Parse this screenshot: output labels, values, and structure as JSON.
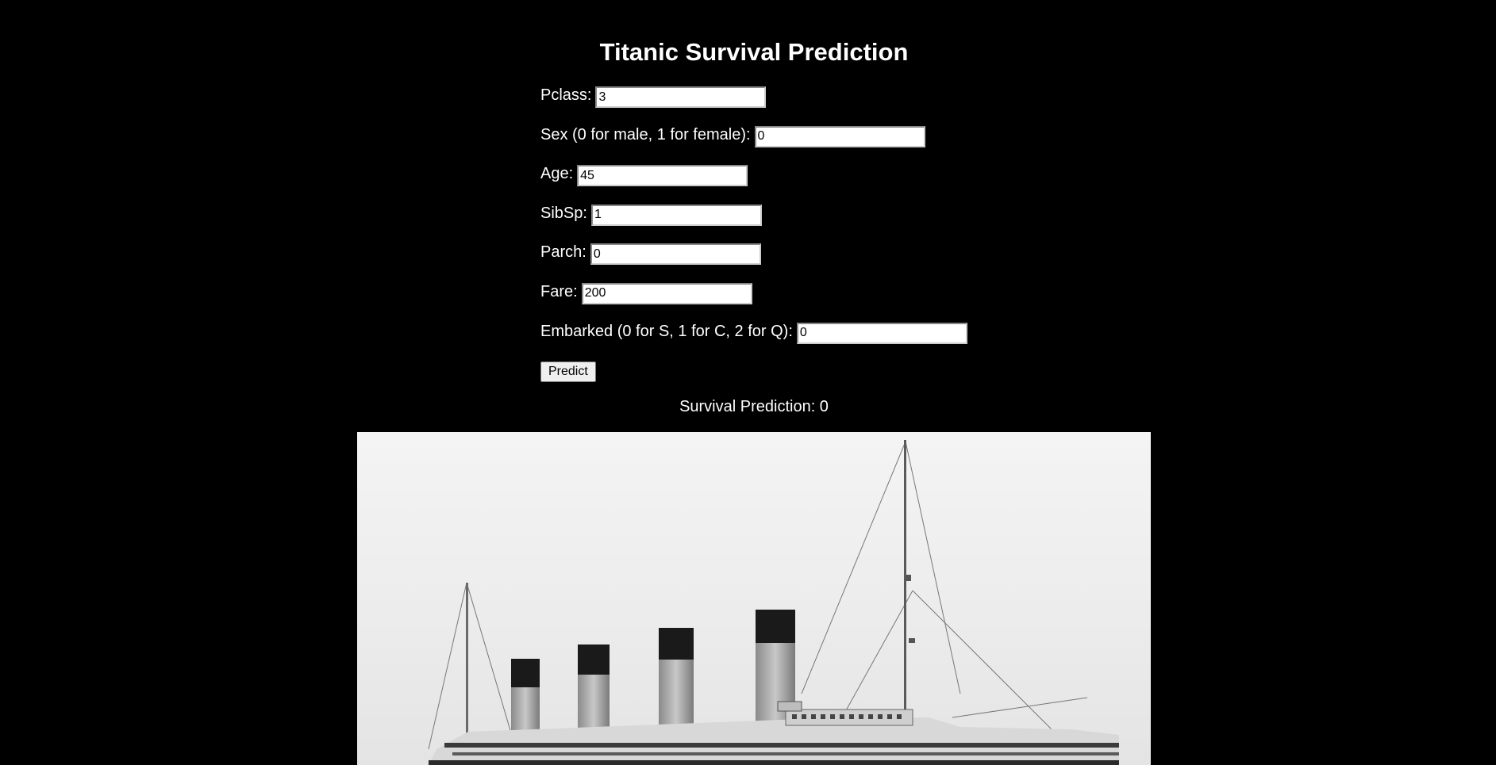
{
  "page": {
    "title": "Titanic Survival Prediction"
  },
  "form": {
    "fields": [
      {
        "label": "Pclass:",
        "value": "3"
      },
      {
        "label": "Sex (0 for male, 1 for female):",
        "value": "0"
      },
      {
        "label": "Age:",
        "value": "45"
      },
      {
        "label": "SibSp:",
        "value": "1"
      },
      {
        "label": "Parch:",
        "value": "0"
      },
      {
        "label": "Fare:",
        "value": "200"
      },
      {
        "label": "Embarked (0 for S, 1 for C, 2 for Q):",
        "value": "0"
      }
    ],
    "submit_label": "Predict"
  },
  "result": {
    "text": "Survival Prediction: 0"
  },
  "image": {
    "subject": "titanic-ship-photo"
  },
  "colors": {
    "background": "#000000",
    "text": "#ffffff"
  }
}
